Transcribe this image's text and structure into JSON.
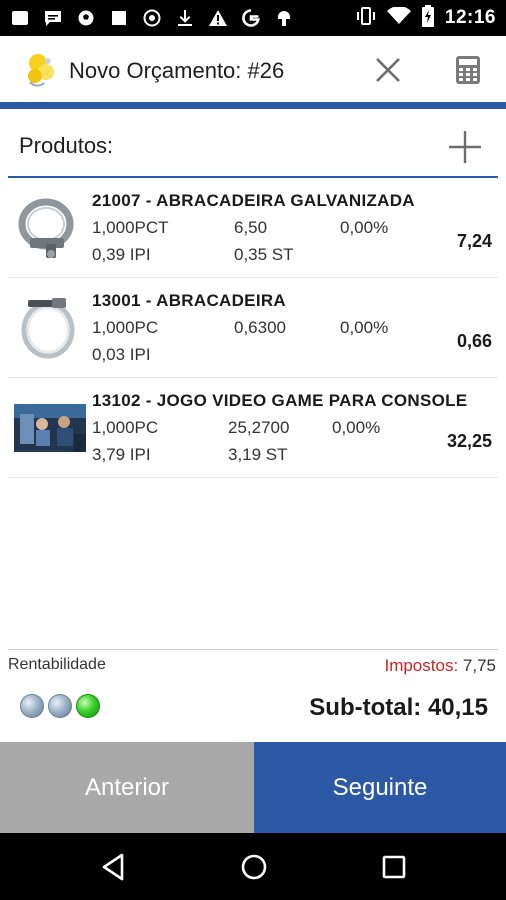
{
  "status_bar": {
    "time": "12:16",
    "icons": [
      "image-icon",
      "message-icon",
      "soccer-icon",
      "square-icon",
      "shield-icon",
      "download-icon",
      "warning-icon",
      "google-icon",
      "android-icon",
      "vibrate-icon",
      "wifi-icon",
      "battery-charging-icon"
    ]
  },
  "toolbar": {
    "title": "Novo Orçamento: #26",
    "close_icon": "close-icon",
    "calculator_icon": "calculator-icon"
  },
  "products": {
    "label": "Produtos:",
    "add_icon": "plus-icon",
    "items": [
      {
        "title": "21007 - ABRACADEIRA GALVANIZADA",
        "qty": "1,000PCT",
        "price": "6,50",
        "discount": "0,00%",
        "ipi": "0,39 IPI",
        "st": "0,35 ST",
        "total": "7,24",
        "thumb": "hose-clamp-image"
      },
      {
        "title": "13001 - ABRACADEIRA",
        "qty": "1,000PC",
        "price": "0,6300",
        "discount": "0,00%",
        "ipi": "0,03 IPI",
        "st": "",
        "total": "0,66",
        "thumb": "clamp-ring-image"
      },
      {
        "title": "13102 - JOGO VIDEO GAME PARA CONSOLE",
        "qty": "1,000PC",
        "price": "25,2700",
        "discount": "0,00%",
        "ipi": "3,79 IPI",
        "st": "3,19 ST",
        "total": "32,25",
        "thumb": "videogame-image"
      }
    ]
  },
  "summary": {
    "rentabilidade_label": "Rentabilidade",
    "impostos_label": "Impostos:",
    "impostos_value": "7,75",
    "lights": [
      "off",
      "off",
      "on"
    ],
    "subtotal": "Sub-total: 40,15"
  },
  "buttons": {
    "prev": "Anterior",
    "next": "Seguinte"
  },
  "colors": {
    "accent": "#2a5aa8",
    "next_button": "#2c58a6",
    "prev_button": "#a9a9a9",
    "taxes_label": "#d42020",
    "light_on": "#38d02a"
  },
  "nav_bar": {
    "icons": [
      "back-icon",
      "home-icon",
      "recent-apps-icon"
    ]
  }
}
